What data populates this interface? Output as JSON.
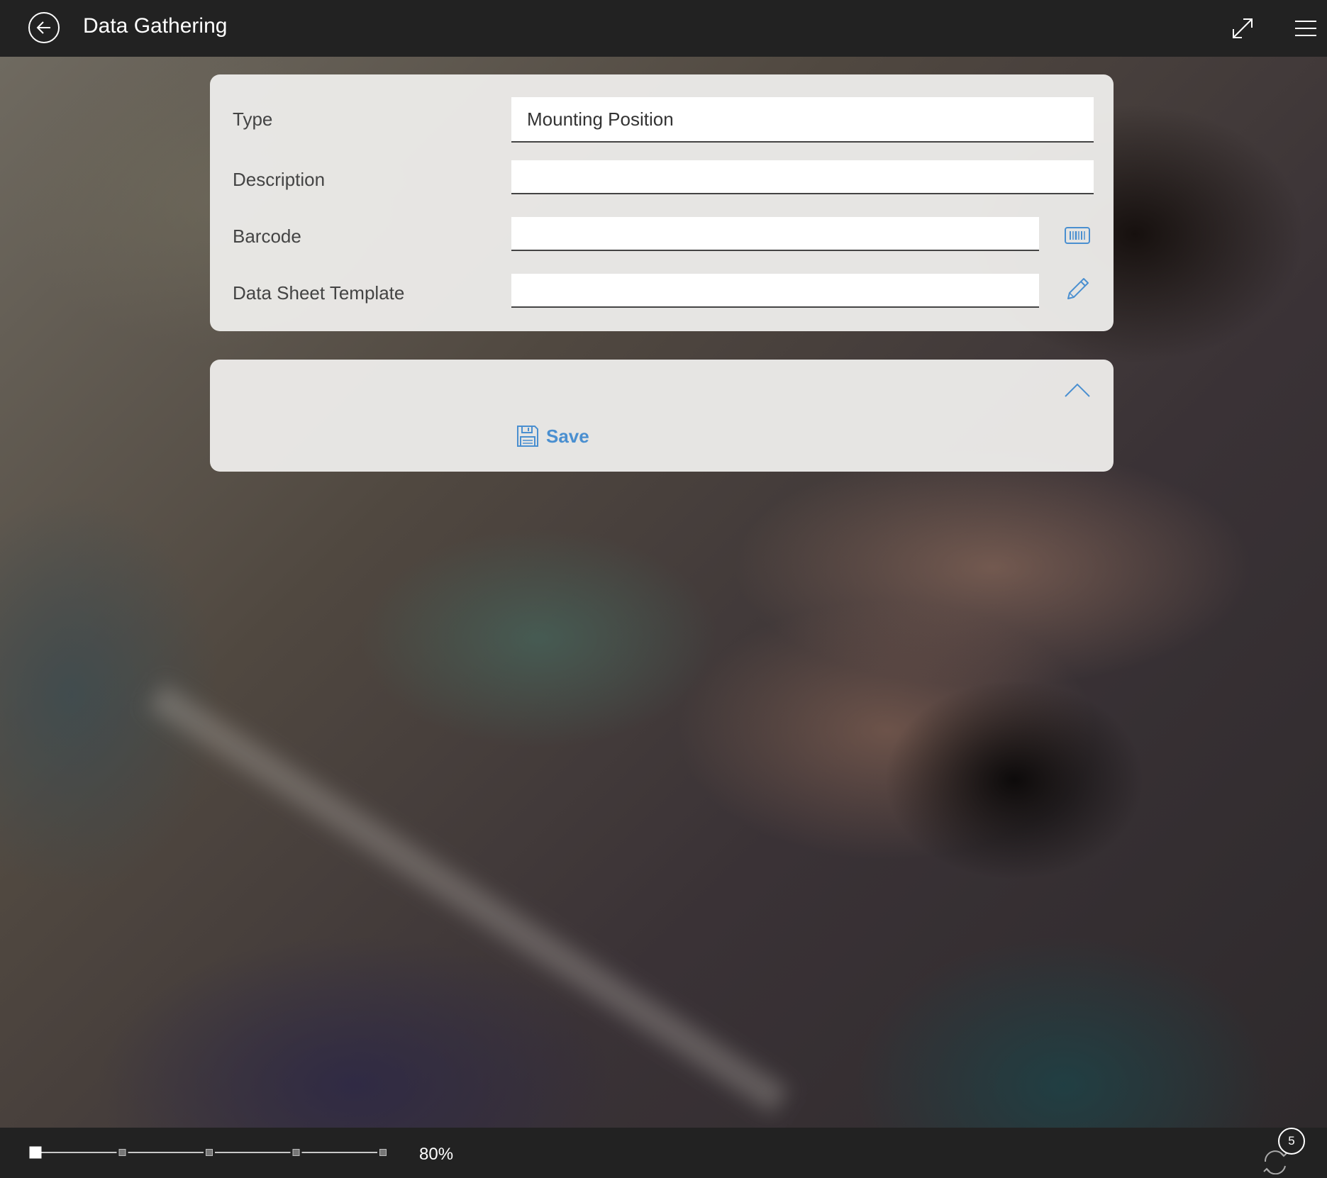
{
  "header": {
    "title": "Data Gathering",
    "back_icon": "back-arrow-icon",
    "expand_icon": "expand-icon",
    "menu_icon": "hamburger-menu-icon"
  },
  "form": {
    "fields": [
      {
        "label": "Type",
        "value": "Mounting Position",
        "placeholder": ""
      },
      {
        "label": "Description",
        "value": "",
        "placeholder": ""
      },
      {
        "label": "Barcode",
        "value": "",
        "placeholder": "",
        "icon": "barcode-scan-icon"
      },
      {
        "label": "Data Sheet Template",
        "value": "",
        "placeholder": "",
        "icon": "pencil-icon"
      }
    ]
  },
  "actions": {
    "collapse_icon": "chevron-up-icon",
    "save_icon": "floppy-disk-icon",
    "save_label": "Save"
  },
  "footer": {
    "zoom_label": "80%",
    "zoom_steps": 5,
    "zoom_current_step": 0,
    "sync_icon": "sync-icon",
    "sync_count": "5"
  },
  "colors": {
    "accent": "#4a8fd0",
    "bar_bg": "#222222",
    "card_bg": "#ebeae8"
  }
}
